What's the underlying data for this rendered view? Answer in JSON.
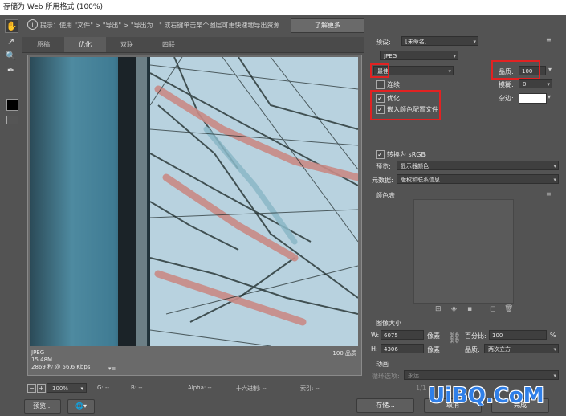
{
  "window": {
    "title": "存储为 Web 所用格式 (100%)"
  },
  "hint": {
    "icon": "info-icon",
    "text": "提示：使用 \"文件\" > \"导出\" > \"导出为...\" 或右键单击某个图层可更快速地导出资源",
    "learn_more": "了解更多"
  },
  "tools": [
    "hand-icon",
    "slice-select-icon",
    "zoom-icon",
    "eyedropper-icon"
  ],
  "tabs": [
    {
      "label": "原稿",
      "active": false
    },
    {
      "label": "优化",
      "active": true
    },
    {
      "label": "双联",
      "active": false
    },
    {
      "label": "四联",
      "active": false
    }
  ],
  "preview": {
    "format": "JPEG",
    "size": "15.48M",
    "time": "2869 秒 @ 56.6 Kbps",
    "quality_note": "100 品质",
    "menu": "▾≡"
  },
  "statusbar": {
    "minus": "−",
    "plus": "+",
    "zoom": "100%",
    "g": "G: --",
    "b": "B: --",
    "alpha": "Alpha: --",
    "hex": "十六进制: --",
    "index": "索引: --"
  },
  "buttons": {
    "preview": "预览...",
    "save": "存储...",
    "cancel": "取消",
    "done": "完成"
  },
  "panel": {
    "preset_label": "预设:",
    "preset_value": "[未命名]",
    "format_value": "JPEG",
    "quality_level": "最佳",
    "quality_label": "品质:",
    "quality_value": "100",
    "progressive_label": "连续",
    "blur_label": "模糊:",
    "blur_value": "0",
    "optimized_label": "优化",
    "embed_profile_label": "嵌入颜色配置文件",
    "matte_label": "杂边:",
    "convert_srgb_label": "转换为 sRGB",
    "preview_label": "预览:",
    "preview_value": "显示器颜色",
    "metadata_label": "元数据:",
    "metadata_value": "版权和联系信息",
    "color_table_label": "颜色表",
    "image_size_label": "图像大小",
    "w_label": "W:",
    "w_value": "6075",
    "h_label": "H:",
    "h_value": "4306",
    "px_unit": "像素",
    "percent_label": "百分比:",
    "percent_value": "100",
    "percent_unit": "%",
    "resample_label": "品质:",
    "resample_value": "两次立方",
    "animation_label": "动画",
    "loop_label": "循环选项:",
    "loop_value": "永远",
    "frame_counter": "1/1"
  },
  "colors": {
    "highlight": "#e22222",
    "watermark": "#2f7fe8"
  },
  "watermark": "UiBQ.CoM"
}
